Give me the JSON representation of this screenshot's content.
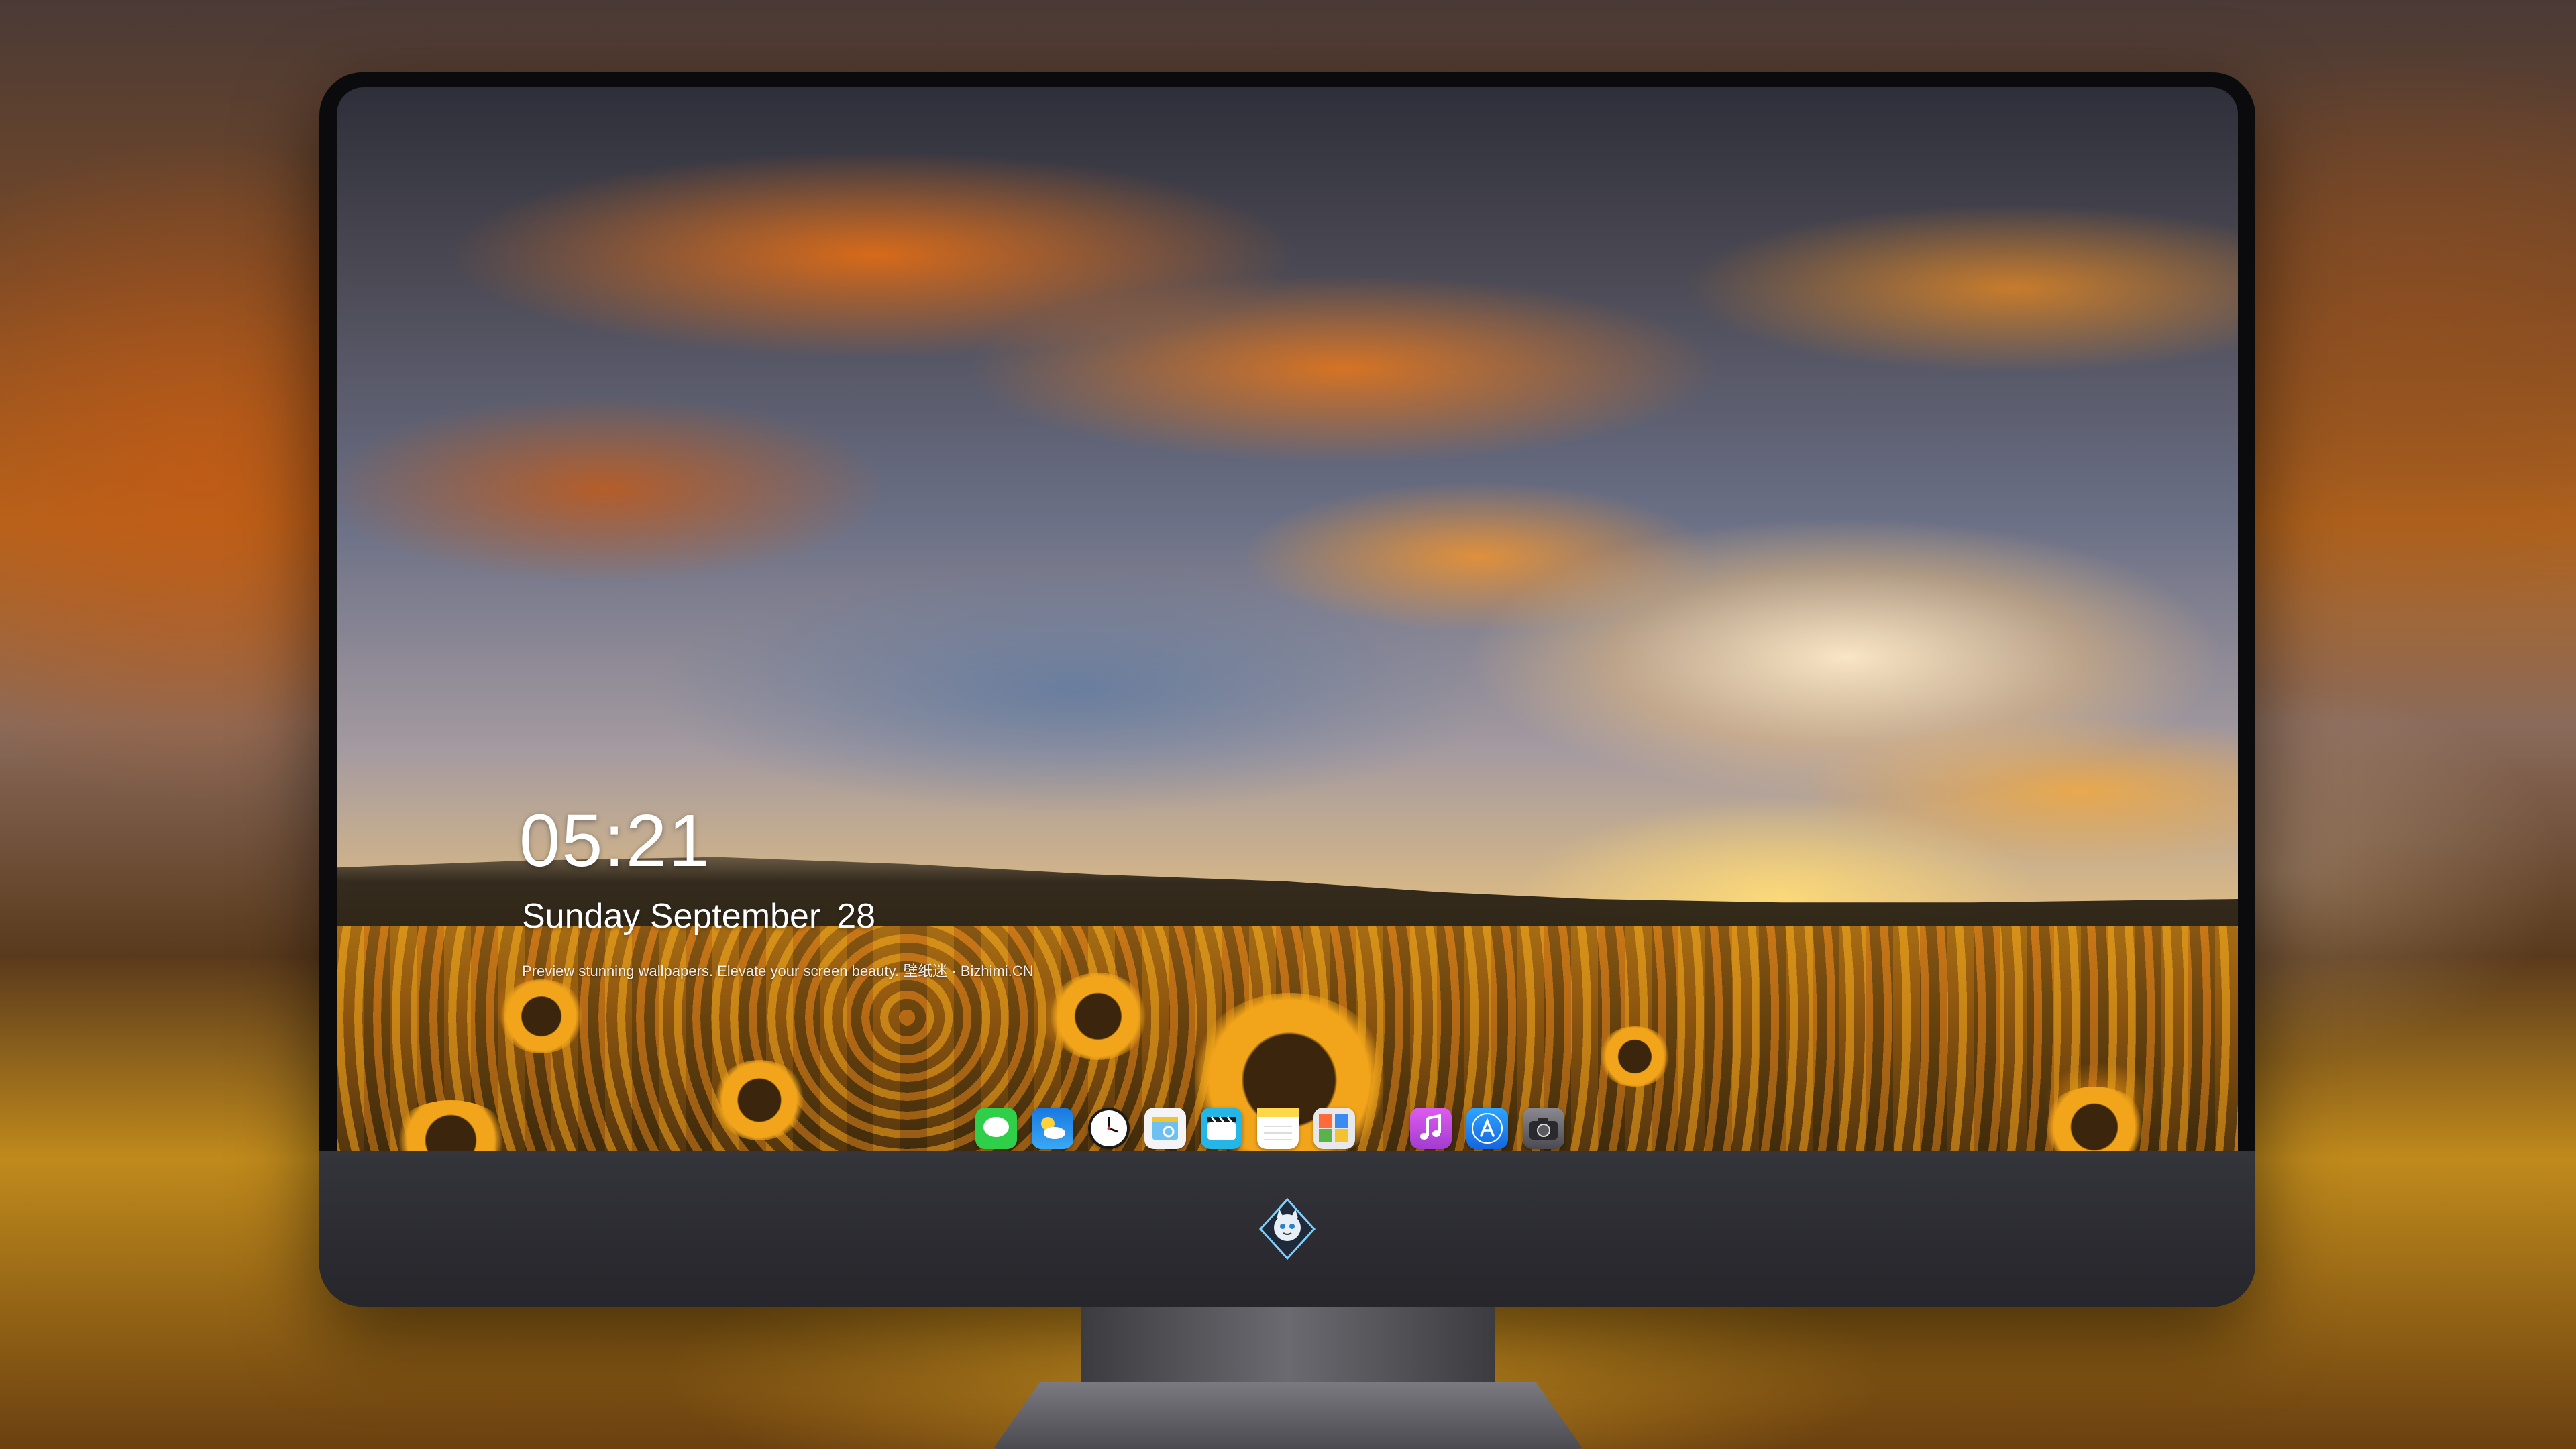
{
  "lockscreen": {
    "time": "05:21",
    "weekday_month": "Sunday September",
    "day": "28",
    "caption": "Preview stunning wallpapers. Elevate your screen beauty. 壁纸迷 · Bizhimi.CN"
  },
  "dock": {
    "apps": [
      {
        "icon": "messages-icon",
        "color": "#2fcf4a"
      },
      {
        "icon": "weather-icon",
        "color": "#1e8de8"
      },
      {
        "icon": "clock-icon",
        "color": "#ffffff"
      },
      {
        "icon": "preview-icon",
        "color": "#f2c230"
      },
      {
        "icon": "clips-icon",
        "color": "#25b6e8"
      },
      {
        "icon": "notes-icon",
        "color": "#ffd84a"
      },
      {
        "icon": "photos-icon",
        "color": "#5ab34a"
      },
      {
        "icon": "music-icon",
        "color": "#c547d6"
      },
      {
        "icon": "app-store-icon",
        "color": "#1d86f0"
      },
      {
        "icon": "camera-icon",
        "color": "#6a6a70"
      }
    ]
  },
  "monitor": {
    "logo": "mascot-logo-icon"
  }
}
